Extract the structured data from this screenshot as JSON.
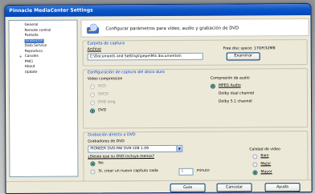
{
  "window": {
    "title": "Pinnacle MediaCenter Settings"
  },
  "sidebar": {
    "items": [
      {
        "label": "General",
        "selected": false
      },
      {
        "label": "Remote control",
        "selected": false
      },
      {
        "label": "Pantalla",
        "selected": false
      },
      {
        "label": "Grabación",
        "selected": true
      },
      {
        "label": "Data Service",
        "selected": false
      },
      {
        "label": "Reproducc.",
        "selected": false
      },
      {
        "label": "Canales",
        "selected": false
      },
      {
        "label": "PMCi",
        "selected": false
      },
      {
        "label": "About",
        "selected": false
      },
      {
        "label": "Update",
        "selected": false
      }
    ]
  },
  "header": {
    "text": "Configurar parámetros para vídeo, audio y grabación de DVD"
  },
  "capture_folder": {
    "title": "Carpeta de captura",
    "file_label": "Archivo",
    "path_value": "C:\\Documents and Settings\\pepe\\Mis documentos\\",
    "free_space": "Free disc space: 17GP/32MB",
    "browse_label": "Examinar"
  },
  "hdd_capture": {
    "title": "Configuración de captura del disco duro",
    "video_title": "Vídeo compression",
    "video_options": [
      "VCD",
      "SVCD",
      "DVD long",
      "DVD"
    ],
    "video_selected": 3,
    "audio_title": "Compresión de audio",
    "audio_options": [
      "MPEG Audio",
      "Dolby dual channel",
      "Dolby 5.1 channel"
    ]
  },
  "dvd_record": {
    "title": "Grabación directa a DVD",
    "recorder_label": "Grabadores de DVD",
    "recorder_value": "PIONEER DVD-RW DVR-108 1.09",
    "ask_label": "¿Desea que su DVD incluya menús?",
    "yes_label": "No",
    "chapter_label": "Sí, crear un nuevo capítulo cada",
    "chapter_value": "5",
    "minutes_label": "minuto",
    "quality_title": "Calidad de vídeo",
    "quality_options": [
      "Bien",
      "Mejor",
      "Mayor"
    ]
  },
  "footer": {
    "save_label": "Guía",
    "cancel_label": "Cancelar",
    "help_label": "Ayuda"
  }
}
